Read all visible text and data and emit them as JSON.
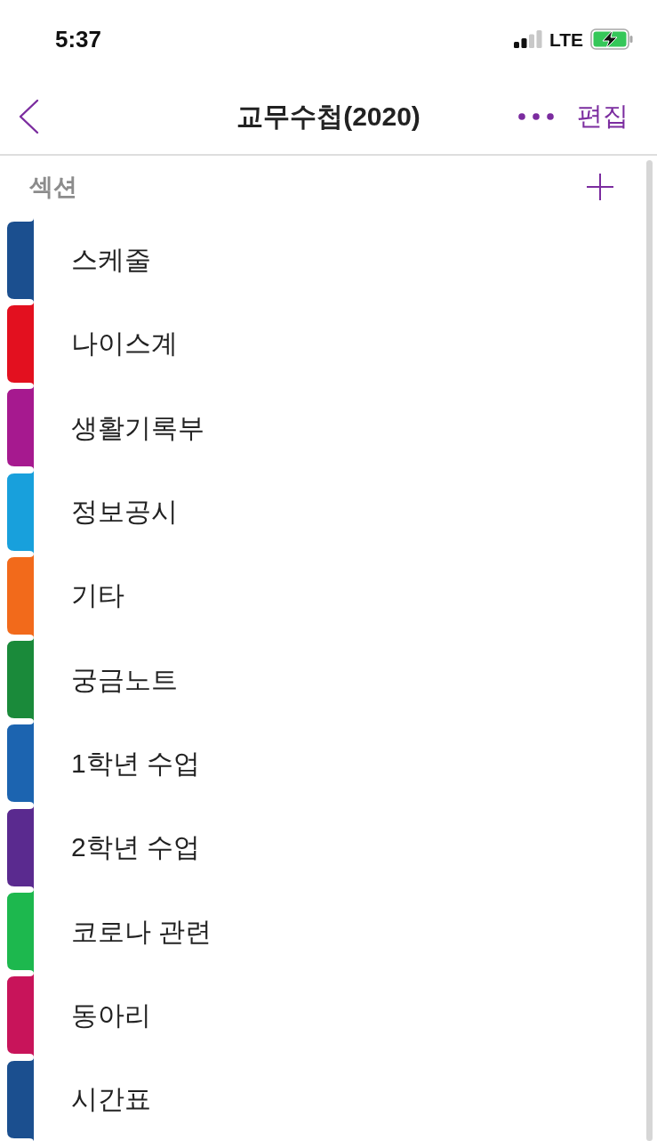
{
  "status_bar": {
    "time": "5:37",
    "network": "LTE"
  },
  "header": {
    "title": "교무수첩(2020)",
    "edit": "편집"
  },
  "sections": {
    "heading": "섹션",
    "items": [
      {
        "name": "스케줄",
        "color": "#1b4f8f"
      },
      {
        "name": "나이스계",
        "color": "#e3101f"
      },
      {
        "name": "생활기록부",
        "color": "#a6198f"
      },
      {
        "name": "정보공시",
        "color": "#18a0dc"
      },
      {
        "name": "기타",
        "color": "#f26a1b"
      },
      {
        "name": "궁금노트",
        "color": "#1a8a3a"
      },
      {
        "name": "1학년 수업",
        "color": "#1c64b0"
      },
      {
        "name": "2학년 수업",
        "color": "#5a2a8f"
      },
      {
        "name": "코로나 관련",
        "color": "#1db84e"
      },
      {
        "name": "동아리",
        "color": "#c8145a"
      },
      {
        "name": "시간표",
        "color": "#1b4f8f"
      }
    ]
  }
}
